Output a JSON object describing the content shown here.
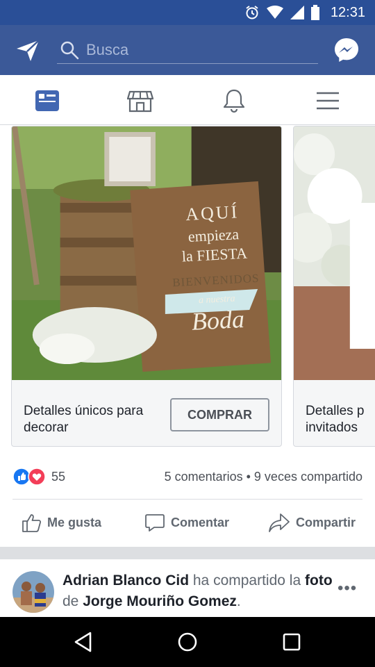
{
  "status": {
    "time": "12:31"
  },
  "search": {
    "placeholder": "Busca"
  },
  "cards": [
    {
      "text": "Detalles únicos para decorar",
      "button": "COMPRAR",
      "sign_lines": [
        "AQUÍ",
        "empieza",
        "la FIESTA",
        "BIENVENIDOS",
        "a nuestra",
        "Boda"
      ]
    },
    {
      "text": "Detalles p invitados"
    }
  ],
  "reactions": {
    "count": "55",
    "meta": "5 comentarios • 9 veces compartido"
  },
  "actions": {
    "like": "Me gusta",
    "comment": "Comentar",
    "share": "Compartir"
  },
  "post": {
    "author": "Adrian Blanco Cid",
    "verb": "ha compartido",
    "article": "la",
    "object": "foto",
    "prep": "de",
    "target": "Jorge Mouriño Gomez",
    "end": ".",
    "more": "•••"
  },
  "colors": {
    "brand": "#3b5998",
    "statusbar": "#2a4f97",
    "like": "#1877f2",
    "love": "#f33e58"
  }
}
